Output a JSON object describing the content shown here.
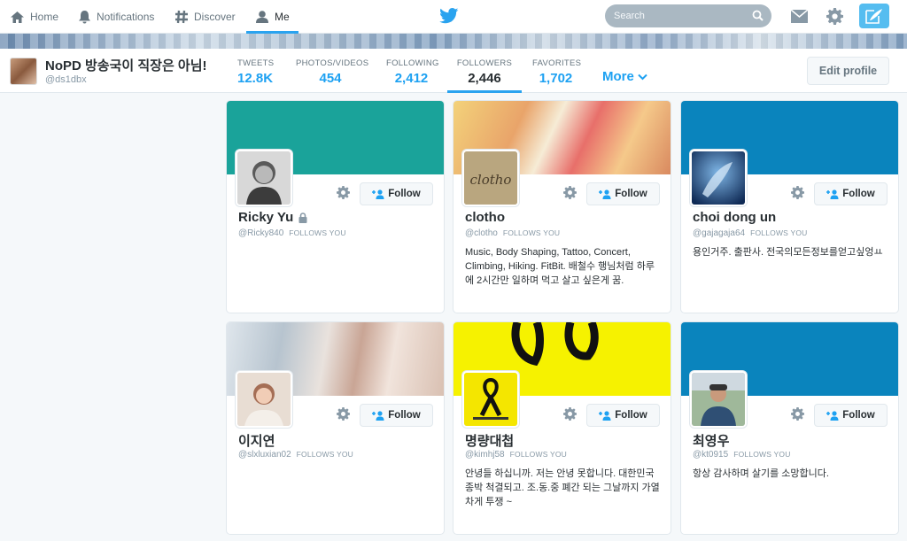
{
  "nav": {
    "home": "Home",
    "notifications": "Notifications",
    "discover": "Discover",
    "me": "Me",
    "search_placeholder": "Search"
  },
  "profile": {
    "name": "NoPD 방송국이 직장은 아님!",
    "handle": "@ds1dbx",
    "edit_label": "Edit profile",
    "more_label": "More"
  },
  "stats": [
    {
      "label": "TWEETS",
      "value": "12.8K"
    },
    {
      "label": "PHOTOS/VIDEOS",
      "value": "454"
    },
    {
      "label": "FOLLOWING",
      "value": "2,412"
    },
    {
      "label": "FOLLOWERS",
      "value": "2,446"
    },
    {
      "label": "FAVORITES",
      "value": "1,702"
    }
  ],
  "follow_label": "Follow",
  "follows_you_label": "FOLLOWS YOU",
  "cards": [
    {
      "name": "Ricky Yu",
      "handle": "@Ricky840",
      "bio": "",
      "protected": true,
      "header_color": "#1aa39a"
    },
    {
      "name": "clotho",
      "handle": "@clotho",
      "bio": "Music, Body Shaping, Tattoo, Concert, Climbing, Hiking. FitBit. 배철수 행님처럼 하루에 2시간만 일하며 먹고 살고 싶은게 꿈.",
      "protected": false,
      "header_color": "#c89a6a"
    },
    {
      "name": "choi dong un",
      "handle": "@gajagaja64",
      "bio": "용인거주. 출판사. 전국의모든정보를얻고싶엉ㅛ",
      "protected": false,
      "header_color": "#0a84bd"
    },
    {
      "name": "이지연",
      "handle": "@slxluxian02",
      "bio": "",
      "protected": false,
      "header_color": "#c7cfd6"
    },
    {
      "name": "명량대첩",
      "handle": "@kimhj58",
      "bio": "안녕들 하십니까. 저는 안녕 못합니다. 대한민국 종박 척결되고. 조.동.중 폐간 되는 그날까지 가열차게 투쟁 ~",
      "protected": false,
      "header_color": "#f6f200"
    },
    {
      "name": "최영우",
      "handle": "@kt0915",
      "bio": "항상 감사하며 살기를 소망합니다.",
      "protected": false,
      "header_color": "#0a84bd"
    }
  ],
  "colors": {
    "accent": "#1da1f2",
    "compose": "#55bdf0"
  }
}
